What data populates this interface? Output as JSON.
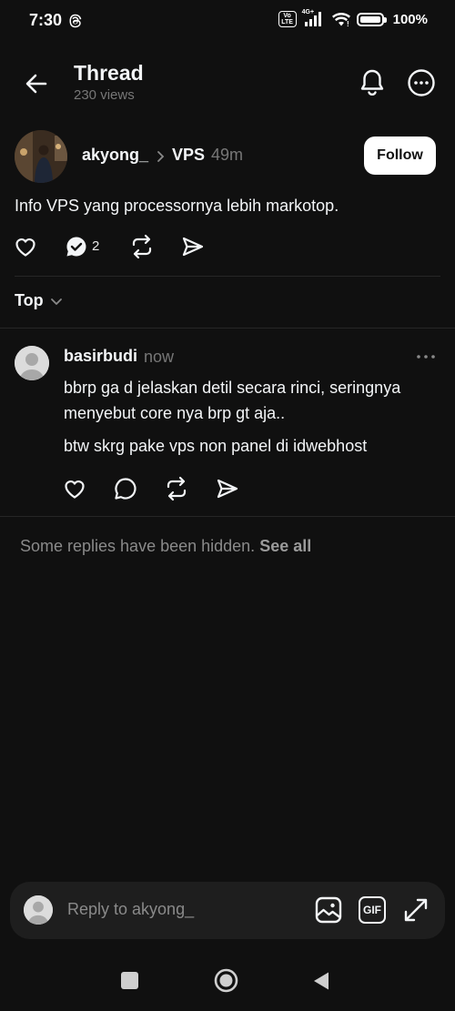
{
  "status_bar": {
    "time": "7:30",
    "volte_label": "Vo\nLTE",
    "network_label": "4G+",
    "battery": "100%"
  },
  "header": {
    "title": "Thread",
    "views": "230 views"
  },
  "post": {
    "author": "akyong_",
    "separator": ">",
    "topic": "VPS",
    "time": "49m",
    "follow_label": "Follow",
    "text": "Info VPS yang processornya lebih markotop.",
    "reply_count": "2"
  },
  "sort": {
    "label": "Top"
  },
  "reply": {
    "author": "basirbudi",
    "time": "now",
    "text_1": "bbrp ga d jelaskan detil secara rinci, seringnya menyebut core nya brp gt aja..",
    "text_2": "btw skrg pake vps non panel di idwebhost"
  },
  "hidden_notice": {
    "text": "Some replies have been hidden.",
    "link": "See all"
  },
  "composer": {
    "placeholder": "Reply to akyong_",
    "gif_label": "GIF"
  },
  "icons": {
    "back": "arrow-left-icon",
    "bell": "bell-icon",
    "more": "more-circle-icon",
    "like": "heart-icon",
    "reply": "comment-icon",
    "repost": "repost-icon",
    "share": "send-icon"
  },
  "colors": {
    "background": "#101010",
    "text_primary": "#f3f5f7",
    "text_secondary": "#777777",
    "divider": "#262626",
    "composer_bg": "#1e1e1e"
  }
}
